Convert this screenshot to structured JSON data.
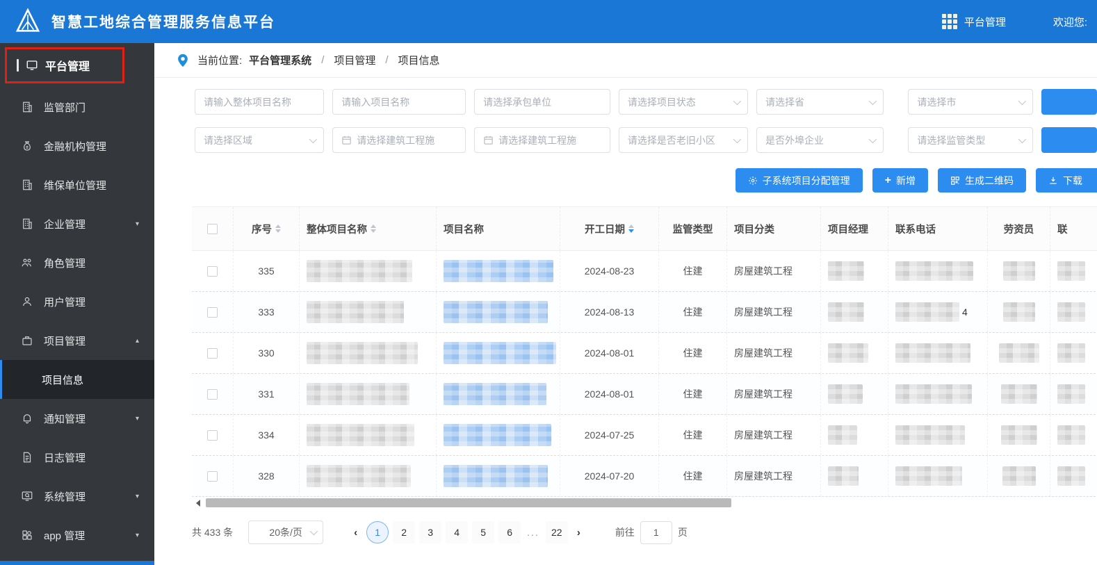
{
  "header": {
    "title": "智慧工地综合管理服务信息平台",
    "nav_label": "平台管理",
    "welcome": "欢迎您:"
  },
  "sidebar": {
    "top_item": "平台管理",
    "items": [
      {
        "label": "监管部门"
      },
      {
        "label": "金融机构管理"
      },
      {
        "label": "维保单位管理"
      },
      {
        "label": "企业管理",
        "arrow": "▾"
      },
      {
        "label": "角色管理"
      },
      {
        "label": "用户管理"
      },
      {
        "label": "项目管理",
        "arrow": "▴"
      }
    ],
    "active_subitem": "项目信息",
    "items2": [
      {
        "label": "通知管理",
        "arrow": "▾"
      },
      {
        "label": "日志管理"
      },
      {
        "label": "系统管理",
        "arrow": "▾"
      },
      {
        "label": "app 管理",
        "arrow": "▾"
      }
    ]
  },
  "breadcrumb": {
    "prefix": "当前位置:",
    "root": "平台管理系统",
    "sep1": "/",
    "level1": "项目管理",
    "sep2": "/",
    "level2": "项目信息"
  },
  "filters": {
    "overall_name_placeholder": "请输入整体项目名称",
    "project_name_placeholder": "请输入项目名称",
    "contractor_placeholder": "请选择承包单位",
    "status_placeholder": "请选择项目状态",
    "province_placeholder": "请选择省",
    "city_placeholder": "请选择市",
    "region_placeholder": "请选择区域",
    "permit_date_start_placeholder": "请选择建筑工程施",
    "permit_date_end_placeholder": "请选择建筑工程施",
    "old_community_placeholder": "请选择是否老旧小区",
    "external_enterprise_placeholder": "是否外埠企业",
    "supervision_type_placeholder": "请选择监管类型"
  },
  "actions": {
    "subsystem_label": "子系统项目分配管理",
    "add_label": "新增",
    "qrcode_label": "生成二维码",
    "download_label": "下载"
  },
  "table": {
    "headers": [
      "序号",
      "整体项目名称",
      "项目名称",
      "开工日期",
      "监管类型",
      "项目分类",
      "项目经理",
      "联系电话",
      "劳资员",
      "联"
    ],
    "rows": [
      {
        "seq": "335",
        "date": "2024-08-23",
        "type": "住建",
        "category": "房屋建筑工程",
        "phone_visible": ""
      },
      {
        "seq": "333",
        "date": "2024-08-13",
        "type": "住建",
        "category": "房屋建筑工程",
        "phone_visible": "4"
      },
      {
        "seq": "330",
        "date": "2024-08-01",
        "type": "住建",
        "category": "房屋建筑工程",
        "phone_visible": ""
      },
      {
        "seq": "331",
        "date": "2024-08-01",
        "type": "住建",
        "category": "房屋建筑工程",
        "phone_visible": ""
      },
      {
        "seq": "334",
        "date": "2024-07-25",
        "type": "住建",
        "category": "房屋建筑工程",
        "phone_visible": ""
      },
      {
        "seq": "328",
        "date": "2024-07-20",
        "type": "住建",
        "category": "房屋建筑工程",
        "phone_visible": ""
      }
    ]
  },
  "pagination": {
    "total": "共 433 条",
    "page_size": "20条/页",
    "prev": "‹",
    "next": "›",
    "pages": [
      "1",
      "2",
      "3",
      "4",
      "5",
      "6"
    ],
    "ellipsis": "...",
    "last_page": "22",
    "goto_label": "前往",
    "goto_value": "1",
    "goto_suffix": "页"
  },
  "colors": {
    "header_blue": "#1b77d6",
    "accent_blue": "#2d8cf0",
    "annotation_red": "#de2315",
    "sidebar_bg": "#34383d"
  }
}
